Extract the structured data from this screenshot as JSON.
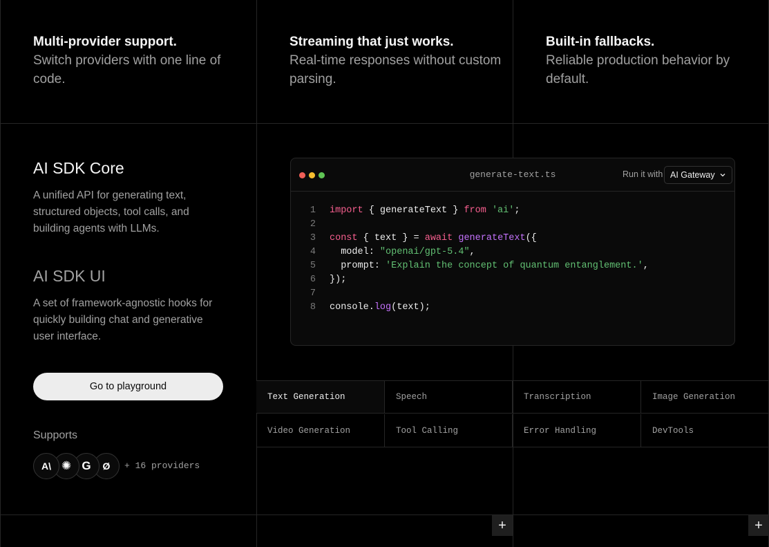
{
  "features": [
    {
      "title": "Multi-provider support.",
      "desc": "Switch providers with one line of code."
    },
    {
      "title": "Streaming that just works.",
      "desc": "Real-time responses without custom parsing."
    },
    {
      "title": "Built-in fallbacks.",
      "desc": "Reliable production behavior by default."
    }
  ],
  "core": {
    "title": "AI SDK Core",
    "desc": "A unified API for generating text, structured objects, tool calls, and building agents with LLMs."
  },
  "ui": {
    "title": "AI SDK UI",
    "desc": "A set of framework-agnostic hooks for quickly building chat and generative user interface."
  },
  "playground_label": "Go to playground",
  "supports": {
    "label": "Supports",
    "providers": [
      {
        "name": "anthropic-icon",
        "glyph": "A\\"
      },
      {
        "name": "openai-icon",
        "glyph": "✺"
      },
      {
        "name": "google-icon",
        "glyph": "G"
      },
      {
        "name": "xai-icon",
        "glyph": "Ø"
      }
    ],
    "more": "+ 16 providers"
  },
  "code": {
    "filename": "generate-text.ts",
    "run_label": "Run it with",
    "gateway_value": "AI Gateway",
    "lines": [
      {
        "n": "1",
        "tokens": [
          [
            "keyword",
            "import"
          ],
          [
            "default",
            " { generateText } "
          ],
          [
            "keyword",
            "from"
          ],
          [
            "default",
            " "
          ],
          [
            "string",
            "'ai'"
          ],
          [
            "default",
            ";"
          ]
        ]
      },
      {
        "n": "2",
        "tokens": []
      },
      {
        "n": "3",
        "tokens": [
          [
            "keyword",
            "const"
          ],
          [
            "default",
            " { text } = "
          ],
          [
            "keyword",
            "await"
          ],
          [
            "default",
            " "
          ],
          [
            "function",
            "generateText"
          ],
          [
            "default",
            "({"
          ]
        ]
      },
      {
        "n": "4",
        "tokens": [
          [
            "default",
            "  model: "
          ],
          [
            "string",
            "\"openai/gpt-5.4\""
          ],
          [
            "default",
            ","
          ]
        ]
      },
      {
        "n": "5",
        "tokens": [
          [
            "default",
            "  prompt: "
          ],
          [
            "string",
            "'Explain the concept of quantum entanglement.'"
          ],
          [
            "default",
            ","
          ]
        ]
      },
      {
        "n": "6",
        "tokens": [
          [
            "default",
            "});"
          ]
        ]
      },
      {
        "n": "7",
        "tokens": []
      },
      {
        "n": "8",
        "tokens": [
          [
            "default",
            "console."
          ],
          [
            "function",
            "log"
          ],
          [
            "default",
            "(text);"
          ]
        ]
      }
    ]
  },
  "tabs": [
    {
      "label": "Text Generation",
      "active": true
    },
    {
      "label": "Speech",
      "active": false
    },
    {
      "label": "Transcription",
      "active": false
    },
    {
      "label": "Image Generation",
      "active": false
    },
    {
      "label": "Video Generation",
      "active": false
    },
    {
      "label": "Tool Calling",
      "active": false
    },
    {
      "label": "Error Handling",
      "active": false
    },
    {
      "label": "DevTools",
      "active": false
    }
  ],
  "plus_glyph": "+",
  "colors": {
    "dot_red": "#ef5f57",
    "dot_yellow": "#f5bd2f",
    "dot_green": "#5fc454"
  }
}
